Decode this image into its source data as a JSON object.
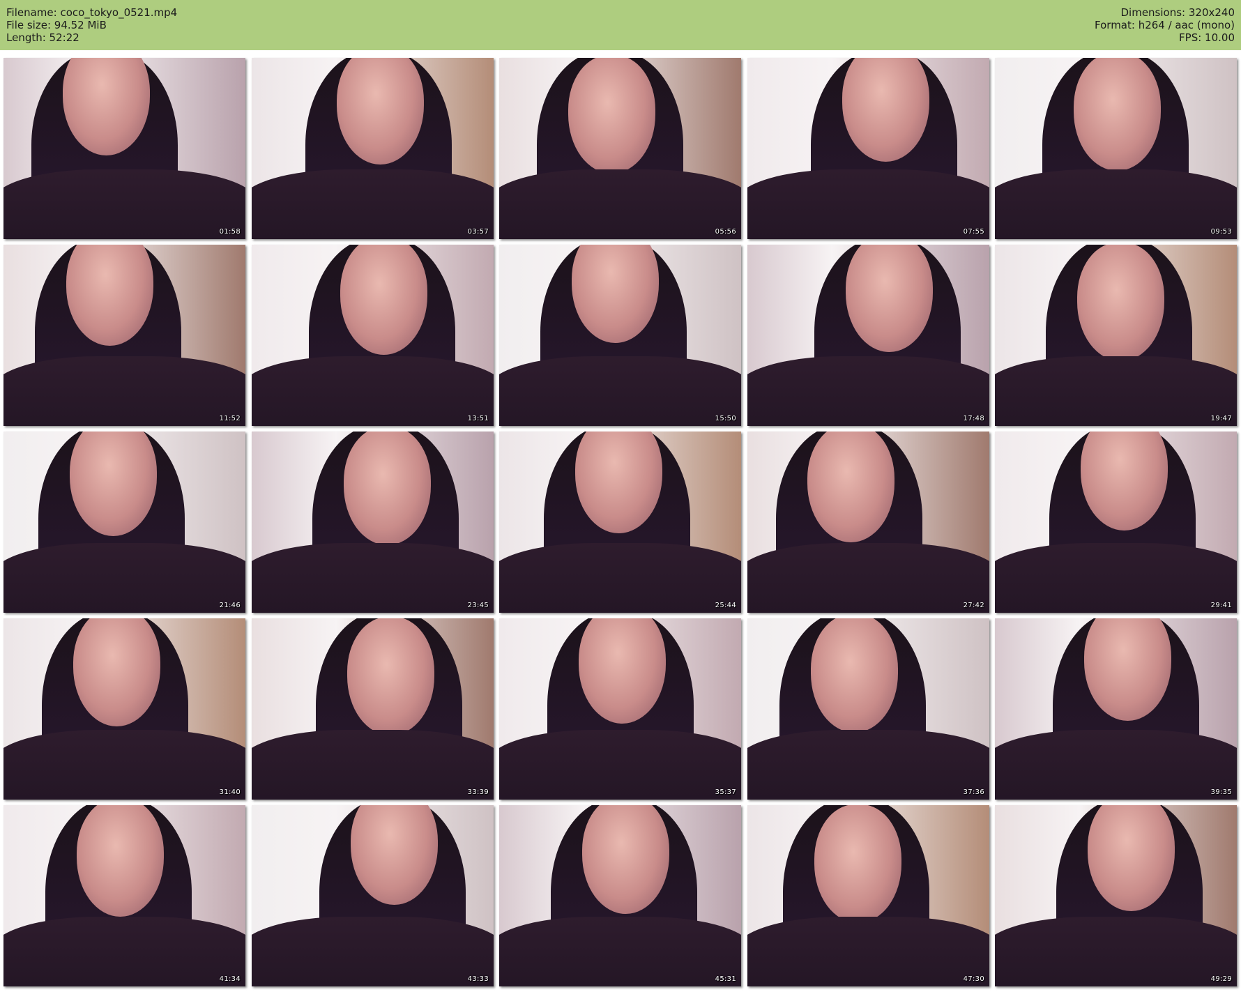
{
  "header": {
    "filename": "Filename: coco_tokyo_0521.mp4",
    "filesize": "File size: 94.52 MiB",
    "length": "Length: 52:22",
    "dimensions": "Dimensions: 320x240",
    "format": "Format: h264 / aac (mono)",
    "fps": "FPS: 10.00"
  },
  "colors": {
    "header_bg": "#aecd7f",
    "page_bg": "#ffffff"
  },
  "thumbnails": [
    {
      "time": "01:58"
    },
    {
      "time": "03:57"
    },
    {
      "time": "05:56"
    },
    {
      "time": "07:55"
    },
    {
      "time": "09:53"
    },
    {
      "time": "11:52"
    },
    {
      "time": "13:51"
    },
    {
      "time": "15:50"
    },
    {
      "time": "17:48"
    },
    {
      "time": "19:47"
    },
    {
      "time": "21:46"
    },
    {
      "time": "23:45"
    },
    {
      "time": "25:44"
    },
    {
      "time": "27:42"
    },
    {
      "time": "29:41"
    },
    {
      "time": "31:40"
    },
    {
      "time": "33:39"
    },
    {
      "time": "35:37"
    },
    {
      "time": "37:36"
    },
    {
      "time": "39:35"
    },
    {
      "time": "41:34"
    },
    {
      "time": "43:33"
    },
    {
      "time": "45:31"
    },
    {
      "time": "47:30"
    },
    {
      "time": "49:29"
    }
  ]
}
